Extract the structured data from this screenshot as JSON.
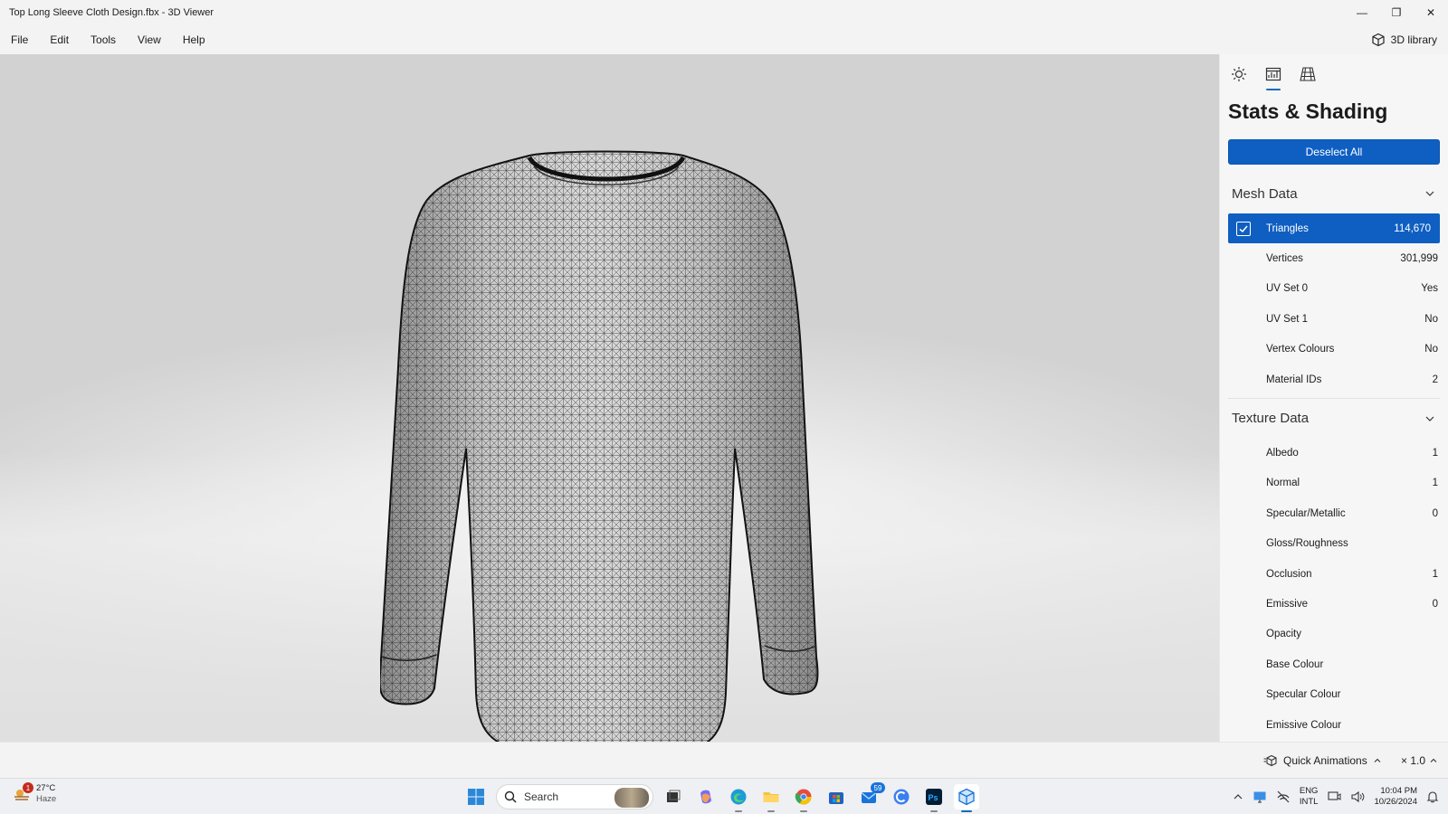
{
  "window": {
    "title": "Top Long Sleeve Cloth Design.fbx - 3D Viewer",
    "minimize": "—",
    "restore": "❐",
    "close": "✕"
  },
  "menu": {
    "items": [
      "File",
      "Edit",
      "Tools",
      "View",
      "Help"
    ],
    "library_label": "3D library",
    "library_icon": "cube-icon"
  },
  "panel": {
    "tabs": [
      "lighting-icon",
      "stats-icon",
      "grid-icon"
    ],
    "active_tab": 1,
    "title": "Stats & Shading",
    "deselect_label": "Deselect All",
    "mesh_section": "Mesh Data",
    "mesh_rows": [
      {
        "label": "Triangles",
        "value": "114,670",
        "checked": true
      },
      {
        "label": "Vertices",
        "value": "301,999"
      },
      {
        "label": "UV Set 0",
        "value": "Yes"
      },
      {
        "label": "UV Set 1",
        "value": "No"
      },
      {
        "label": "Vertex Colours",
        "value": "No"
      },
      {
        "label": "Material IDs",
        "value": "2"
      }
    ],
    "texture_section": "Texture Data",
    "texture_rows": [
      {
        "label": "Albedo",
        "value": "1"
      },
      {
        "label": "Normal",
        "value": "1"
      },
      {
        "label": "Specular/Metallic",
        "value": "0"
      },
      {
        "label": "Gloss/Roughness",
        "value": ""
      },
      {
        "label": "Occlusion",
        "value": "1"
      },
      {
        "label": "Emissive",
        "value": "0"
      },
      {
        "label": "Opacity",
        "value": ""
      },
      {
        "label": "Base Colour",
        "value": ""
      },
      {
        "label": "Specular Colour",
        "value": ""
      },
      {
        "label": "Emissive Colour",
        "value": ""
      }
    ],
    "accent_color": "#0f5fc2"
  },
  "status": {
    "quick_animations": "Quick Animations",
    "speed": "× 1.0"
  },
  "taskbar": {
    "weather_temp": "27°C",
    "weather_desc": "Haze",
    "weather_badge": "1",
    "search_placeholder": "Search",
    "mail_badge": "59",
    "lang_top": "ENG",
    "lang_bottom": "INTL",
    "time": "10:04 PM",
    "date": "10/26/2024"
  }
}
